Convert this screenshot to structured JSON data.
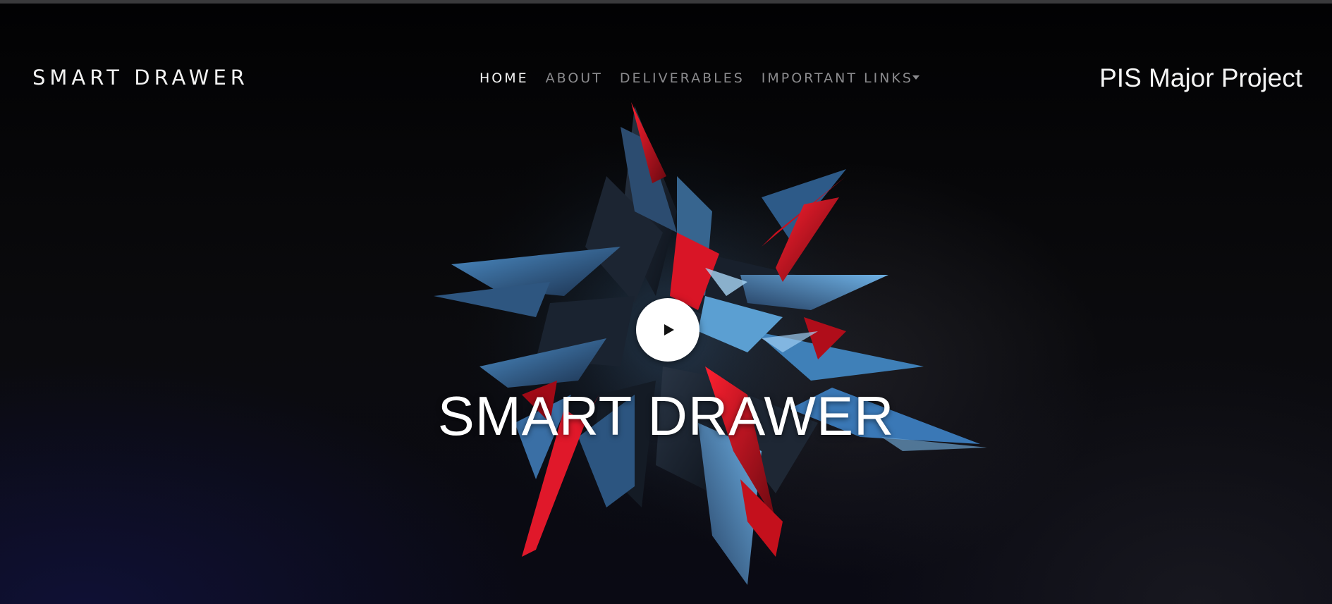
{
  "navbar": {
    "brand": "SMART DRAWER",
    "items": [
      {
        "label": "HOME",
        "active": true
      },
      {
        "label": "ABOUT",
        "active": false
      },
      {
        "label": "DELIVERABLES",
        "active": false
      },
      {
        "label": "IMPORTANT LINKS",
        "active": false,
        "dropdown": true
      }
    ],
    "right_title": "PIS Major Project"
  },
  "hero": {
    "title": "SMART DRAWER",
    "play_icon": "play-icon"
  },
  "colors": {
    "background": "#000000",
    "nav_active": "#f4f4f4",
    "nav_inactive": "#8b8b8e",
    "art_blue": "#3c78b8",
    "art_red": "#e01020"
  }
}
